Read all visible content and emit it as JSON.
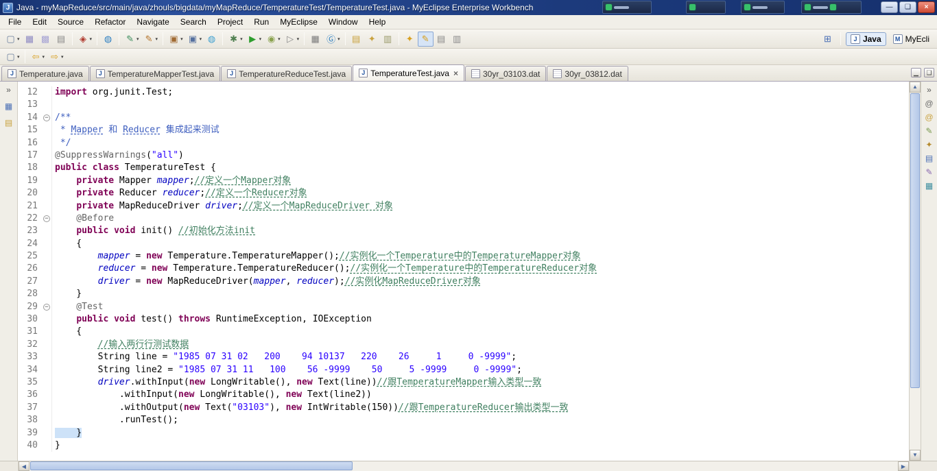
{
  "window": {
    "title": "Java - myMapReduce/src/main/java/zhouls/bigdata/myMapReduce/TemperatureTest/TemperatureTest.java - MyEclipse Enterprise Workbench",
    "app_icon": "J",
    "controls": {
      "minimize": "—",
      "maximize": "❏",
      "close": "×"
    }
  },
  "menu": [
    "File",
    "Edit",
    "Source",
    "Refactor",
    "Navigate",
    "Search",
    "Project",
    "Run",
    "MyEclipse",
    "Window",
    "Help"
  ],
  "toolbar": {
    "row1": [
      [
        {
          "n": "new-wizard-icon",
          "ch": "▢",
          "c": "#6b7f9e",
          "d": 1
        },
        {
          "n": "save-icon",
          "ch": "▦",
          "c": "#8d89c2"
        },
        {
          "n": "save-all-icon",
          "ch": "▩",
          "c": "#a7a4d4"
        },
        {
          "n": "print-icon",
          "ch": "▤",
          "c": "#8a8a8a"
        }
      ],
      [
        {
          "n": "myeclipse-deploy-icon",
          "ch": "◈",
          "c": "#b03a2e",
          "d": 1
        }
      ],
      [
        {
          "n": "web-browser-icon",
          "ch": "◍",
          "c": "#2e7fc1"
        }
      ],
      [
        {
          "n": "new-java-class-icon",
          "ch": "✎",
          "c": "#3f8f5f",
          "d": 1
        },
        {
          "n": "new-web-component-icon",
          "ch": "✎",
          "c": "#b5762f",
          "d": 1
        }
      ],
      [
        {
          "n": "jar-file-icon",
          "ch": "▣",
          "c": "#a06a32",
          "d": 1
        },
        {
          "n": "war-file-icon",
          "ch": "▣",
          "c": "#55709e",
          "d": 1
        },
        {
          "n": "internal-browser-icon",
          "ch": "◍",
          "c": "#3fa0d0"
        }
      ],
      [
        {
          "n": "debug-icon",
          "ch": "✱",
          "c": "#4f7f4f",
          "d": 1
        },
        {
          "n": "run-icon",
          "ch": "▶",
          "c": "#2e9e2e",
          "d": 1
        },
        {
          "n": "coverage-icon",
          "ch": "◉",
          "c": "#8aa24f",
          "d": 1
        },
        {
          "n": "external-tools-icon",
          "ch": "▷",
          "c": "#8a8a8a",
          "d": 1
        }
      ],
      [
        {
          "n": "db-explorer-icon",
          "ch": "▦",
          "c": "#7a7a7a"
        },
        {
          "n": "browser-g-icon",
          "ch": "Ⓖ",
          "c": "#2e7fc1",
          "d": 1
        }
      ],
      [
        {
          "n": "open-web-page-icon",
          "ch": "▤",
          "c": "#c9a23f"
        },
        {
          "n": "sync-browser-icon",
          "ch": "✦",
          "c": "#c9a23f"
        },
        {
          "n": "report-design-icon",
          "ch": "▥",
          "c": "#9a9a6a"
        }
      ],
      [
        {
          "n": "search-icon",
          "ch": "✦",
          "c": "#d8a020"
        },
        {
          "n": "mark-occurrences-icon",
          "ch": "✎",
          "c": "#d8a020",
          "p": 1
        },
        {
          "n": "show-annotations-icon",
          "ch": "▤",
          "c": "#8a8a8a"
        },
        {
          "n": "show-source-icon",
          "ch": "▥",
          "c": "#8a8a8a"
        }
      ]
    ],
    "row2": [
      [
        {
          "n": "editor-presentation-icon",
          "ch": "▢",
          "c": "#6b7f9e",
          "d": 1
        }
      ],
      [
        {
          "n": "back-icon",
          "ch": "⇦",
          "c": "#d8a020",
          "d": 1
        },
        {
          "n": "forward-icon",
          "ch": "⇨",
          "c": "#d8a020",
          "d": 1
        }
      ]
    ]
  },
  "perspectives": {
    "open_perspective_icon": "⊞",
    "items": [
      {
        "label": "Java",
        "icon": "J",
        "active": true
      },
      {
        "label": "MyEcli",
        "icon": "M",
        "active": false
      }
    ]
  },
  "tabs": [
    {
      "label": "Temperature.java",
      "type": "java",
      "active": false
    },
    {
      "label": "TemperatureMapperTest.java",
      "type": "java",
      "active": false
    },
    {
      "label": "TemperatureReduceTest.java",
      "type": "java",
      "active": false
    },
    {
      "label": "TemperatureTest.java",
      "type": "java",
      "active": true,
      "close": "×"
    },
    {
      "label": "30yr_03103.dat",
      "type": "dat",
      "active": false
    },
    {
      "label": "30yr_03812.dat",
      "type": "dat",
      "active": false
    }
  ],
  "tabbar_controls": {
    "minimize": "▁",
    "maximize": "❏"
  },
  "left_strip": [
    {
      "name": "restore-explorer-views-icon",
      "ch": "»",
      "c": "#555"
    },
    {
      "name": "package-explorer-icon",
      "ch": "▦",
      "c": "#4a6fb5"
    },
    {
      "name": "navigator-folder-icon",
      "ch": "▤",
      "c": "#c9a23f"
    }
  ],
  "right_strip": [
    {
      "name": "restore-views-icon",
      "ch": "»",
      "c": "#555"
    },
    {
      "name": "annotations-view-icon",
      "ch": "@",
      "c": "#6a6a6a"
    },
    {
      "name": "javadoc-view-icon",
      "ch": "@",
      "c": "#c9a23f"
    },
    {
      "name": "declaration-view-icon",
      "ch": "✎",
      "c": "#7a9a4f"
    },
    {
      "name": "search-view-icon",
      "ch": "✦",
      "c": "#b58a2e"
    },
    {
      "name": "console-view-icon",
      "ch": "▤",
      "c": "#4a6fb5"
    },
    {
      "name": "snippets-view-icon",
      "ch": "✎",
      "c": "#8a6ab0"
    },
    {
      "name": "outline-view-icon",
      "ch": "▦",
      "c": "#3f8fa0"
    }
  ],
  "editor": {
    "language": "java",
    "lines": [
      {
        "n": "12",
        "s": [
          [
            "import",
            "kw"
          ],
          [
            " org.junit.Test;",
            "pln"
          ]
        ]
      },
      {
        "n": "13",
        "s": []
      },
      {
        "n": "14",
        "fold": true,
        "s": [
          [
            "/**",
            "jdoc"
          ]
        ]
      },
      {
        "n": "15",
        "s": [
          [
            " * ",
            "jdoc"
          ],
          [
            "Mapper",
            "jdoc u"
          ],
          [
            " 和 ",
            "jdoc"
          ],
          [
            "Reducer",
            "jdoc u"
          ],
          [
            " 集成起来测试",
            "jdoc"
          ]
        ]
      },
      {
        "n": "16",
        "s": [
          [
            " */",
            "jdoc"
          ]
        ]
      },
      {
        "n": "17",
        "s": [
          [
            "@SuppressWarnings",
            "ann"
          ],
          [
            "(",
            "pln"
          ],
          [
            "\"all\"",
            "str"
          ],
          [
            ")",
            "pln"
          ]
        ]
      },
      {
        "n": "18",
        "s": [
          [
            "public",
            "kw"
          ],
          [
            " ",
            "pln"
          ],
          [
            "class",
            "kw"
          ],
          [
            " TemperatureTest {",
            "pln"
          ]
        ]
      },
      {
        "n": "19",
        "s": [
          [
            "    ",
            "pln"
          ],
          [
            "private",
            "kw"
          ],
          [
            " Mapper ",
            "pln"
          ],
          [
            "mapper",
            "fld"
          ],
          [
            ";",
            "pln"
          ],
          [
            "//定义一个Mapper对象",
            "com u"
          ]
        ]
      },
      {
        "n": "20",
        "s": [
          [
            "    ",
            "pln"
          ],
          [
            "private",
            "kw"
          ],
          [
            " Reducer ",
            "pln"
          ],
          [
            "reducer",
            "fld"
          ],
          [
            ";",
            "pln"
          ],
          [
            "//定义一个Reducer对象",
            "com u"
          ]
        ]
      },
      {
        "n": "21",
        "s": [
          [
            "    ",
            "pln"
          ],
          [
            "private",
            "kw"
          ],
          [
            " MapReduceDriver ",
            "pln"
          ],
          [
            "driver",
            "fld"
          ],
          [
            ";",
            "pln"
          ],
          [
            "//定义一个MapReduceDriver 对象",
            "com u"
          ]
        ]
      },
      {
        "n": "22",
        "fold": true,
        "s": [
          [
            "    @Before",
            "ann"
          ]
        ]
      },
      {
        "n": "23",
        "s": [
          [
            "    ",
            "pln"
          ],
          [
            "public",
            "kw"
          ],
          [
            " ",
            "pln"
          ],
          [
            "void",
            "kw"
          ],
          [
            " init() ",
            "pln"
          ],
          [
            "//初始化方法init",
            "com u"
          ]
        ]
      },
      {
        "n": "24",
        "s": [
          [
            "    {",
            "pln"
          ]
        ]
      },
      {
        "n": "25",
        "s": [
          [
            "        ",
            "pln"
          ],
          [
            "mapper",
            "fld"
          ],
          [
            " = ",
            "pln"
          ],
          [
            "new",
            "kw"
          ],
          [
            " Temperature.TemperatureMapper();",
            "pln"
          ],
          [
            "//实例化一个Temperature中的TemperatureMapper对象",
            "com u"
          ]
        ]
      },
      {
        "n": "26",
        "s": [
          [
            "        ",
            "pln"
          ],
          [
            "reducer",
            "fld"
          ],
          [
            " = ",
            "pln"
          ],
          [
            "new",
            "kw"
          ],
          [
            " Temperature.TemperatureReducer();",
            "pln"
          ],
          [
            "//实例化一个Temperature中的TemperatureReducer对象",
            "com u"
          ]
        ]
      },
      {
        "n": "27",
        "s": [
          [
            "        ",
            "pln"
          ],
          [
            "driver",
            "fld"
          ],
          [
            " = ",
            "pln"
          ],
          [
            "new",
            "kw"
          ],
          [
            " MapReduceDriver(",
            "pln"
          ],
          [
            "mapper",
            "fld"
          ],
          [
            ", ",
            "pln"
          ],
          [
            "reducer",
            "fld"
          ],
          [
            ");",
            "pln"
          ],
          [
            "//实例化MapReduceDriver对象",
            "com u"
          ]
        ]
      },
      {
        "n": "28",
        "s": [
          [
            "    }",
            "pln"
          ]
        ]
      },
      {
        "n": "29",
        "fold": true,
        "s": [
          [
            "    @Test",
            "ann"
          ]
        ]
      },
      {
        "n": "30",
        "s": [
          [
            "    ",
            "pln"
          ],
          [
            "public",
            "kw"
          ],
          [
            " ",
            "pln"
          ],
          [
            "void",
            "kw"
          ],
          [
            " test() ",
            "pln"
          ],
          [
            "throws",
            "kw"
          ],
          [
            " RuntimeException, IOException",
            "pln"
          ]
        ]
      },
      {
        "n": "31",
        "s": [
          [
            "    {",
            "pln"
          ]
        ]
      },
      {
        "n": "32",
        "s": [
          [
            "        ",
            "pln"
          ],
          [
            "//输入两行行测试数据",
            "com u"
          ]
        ]
      },
      {
        "n": "33",
        "s": [
          [
            "        String line = ",
            "pln"
          ],
          [
            "\"1985 07 31 02   200    94 10137   220    26     1     0 -9999\"",
            "str"
          ],
          [
            ";",
            "pln"
          ]
        ]
      },
      {
        "n": "34",
        "s": [
          [
            "        String line2 = ",
            "pln"
          ],
          [
            "\"1985 07 31 11   100    56 -9999    50     5 -9999     0 -9999\"",
            "str"
          ],
          [
            ";",
            "pln"
          ]
        ]
      },
      {
        "n": "35",
        "s": [
          [
            "        ",
            "pln"
          ],
          [
            "driver",
            "fld"
          ],
          [
            ".withInput(",
            "pln"
          ],
          [
            "new",
            "kw"
          ],
          [
            " LongWritable(), ",
            "pln"
          ],
          [
            "new",
            "kw"
          ],
          [
            " Text(line))",
            "pln"
          ],
          [
            "//跟TemperatureMapper输入类型一致",
            "com u"
          ]
        ]
      },
      {
        "n": "36",
        "s": [
          [
            "            .withInput(",
            "pln"
          ],
          [
            "new",
            "kw"
          ],
          [
            " LongWritable(), ",
            "pln"
          ],
          [
            "new",
            "kw"
          ],
          [
            " Text(line2))",
            "pln"
          ]
        ]
      },
      {
        "n": "37",
        "s": [
          [
            "            .withOutput(",
            "pln"
          ],
          [
            "new",
            "kw"
          ],
          [
            " Text(",
            "pln"
          ],
          [
            "\"03103\"",
            "str"
          ],
          [
            "), ",
            "pln"
          ],
          [
            "new",
            "kw"
          ],
          [
            " IntWritable(150))",
            "pln"
          ],
          [
            "//跟TemperatureReducer输出类型一致",
            "com u"
          ]
        ]
      },
      {
        "n": "38",
        "s": [
          [
            "            .runTest();",
            "pln"
          ]
        ]
      },
      {
        "n": "39",
        "s": [
          [
            "    }",
            "pln selbg"
          ]
        ]
      },
      {
        "n": "40",
        "s": [
          [
            "}",
            "pln"
          ]
        ]
      }
    ]
  },
  "colors": {
    "keyword": "#7f0055",
    "string": "#2a00ff",
    "comment": "#3f7f5f",
    "javadoc": "#3f5fbf",
    "field": "#0000c0",
    "annotation": "#646464",
    "titlebar": "#1c3a7c",
    "current_line_highlight": "#cde2f8"
  }
}
